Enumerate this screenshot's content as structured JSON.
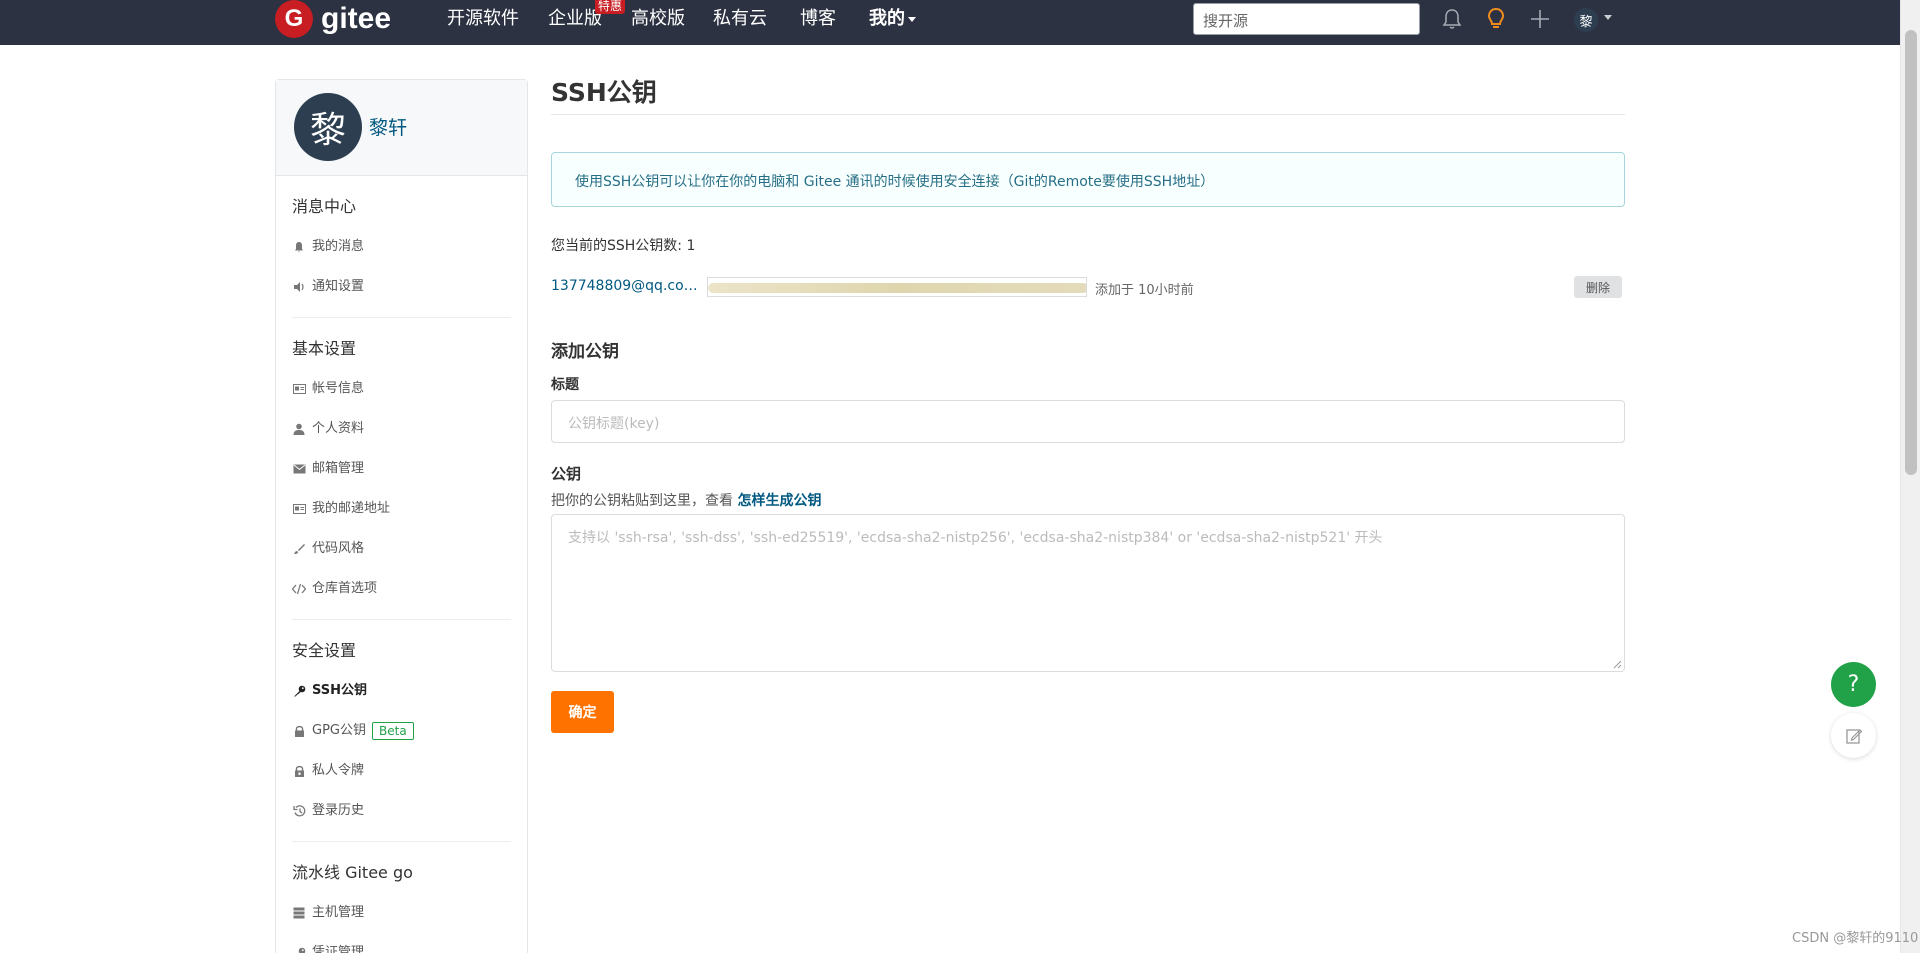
{
  "nav": {
    "logo_letter": "G",
    "logo_text": "gitee",
    "items": [
      "开源软件",
      "企业版",
      "高校版",
      "私有云",
      "博客",
      "我的"
    ],
    "hot_badge": "特惠",
    "search_placeholder": "搜开源",
    "avatar_letter": "黎",
    "icons": [
      "bell-icon",
      "lightbulb-icon",
      "plus-icon"
    ],
    "brand_color": "#c71d23",
    "bar_color": "#2c3242"
  },
  "sidebar": {
    "avatar_letter": "黎",
    "username": "黎轩",
    "sections": [
      {
        "title": "消息中心",
        "items": [
          {
            "label": "我的消息",
            "icon": "bell-icon"
          },
          {
            "label": "通知设置",
            "icon": "volume-icon"
          }
        ]
      },
      {
        "title": "基本设置",
        "items": [
          {
            "label": "帐号信息",
            "icon": "id-card-icon"
          },
          {
            "label": "个人资料",
            "icon": "user-icon"
          },
          {
            "label": "邮箱管理",
            "icon": "mail-icon"
          },
          {
            "label": "我的邮递地址",
            "icon": "address-card-icon"
          },
          {
            "label": "代码风格",
            "icon": "brush-icon"
          },
          {
            "label": "仓库首选项",
            "icon": "code-icon"
          }
        ]
      },
      {
        "title": "安全设置",
        "items": [
          {
            "label": "SSH公钥",
            "icon": "key-icon",
            "active": true
          },
          {
            "label": "GPG公钥",
            "icon": "lock-icon",
            "badge": "Beta"
          },
          {
            "label": "私人令牌",
            "icon": "unlock-icon"
          },
          {
            "label": "登录历史",
            "icon": "history-icon"
          }
        ]
      },
      {
        "title": "流水线 Gitee go",
        "items": [
          {
            "label": "主机管理",
            "icon": "server-icon"
          },
          {
            "label": "凭证管理",
            "icon": "key-icon"
          }
        ]
      }
    ]
  },
  "main": {
    "title": "SSH公钥",
    "info": "使用SSH公钥可以让你在你的电脑和 Gitee 通讯的时候使用安全连接（Git的Remote要使用SSH地址）",
    "count_label": "您当前的SSH公钥数: 1",
    "key": {
      "email": "137748809@qq.co…",
      "added": "添加于 10小时前",
      "delete_label": "删除"
    },
    "add_heading": "添加公钥",
    "title_label": "标题",
    "title_placeholder": "公钥标题(key)",
    "key_label": "公钥",
    "hint_prefix": "把你的公钥粘贴到这里，查看 ",
    "hint_link": "怎样生成公钥",
    "key_placeholder": "支持以 'ssh-rsa', 'ssh-dss', 'ssh-ed25519', 'ecdsa-sha2-nistp256', 'ecdsa-sha2-nistp384' or 'ecdsa-sha2-nistp521' 开头",
    "submit_label": "确定",
    "accent_color": "#fe7300"
  },
  "float": {
    "help": "?"
  },
  "watermark": "CSDN @黎轩的9110"
}
